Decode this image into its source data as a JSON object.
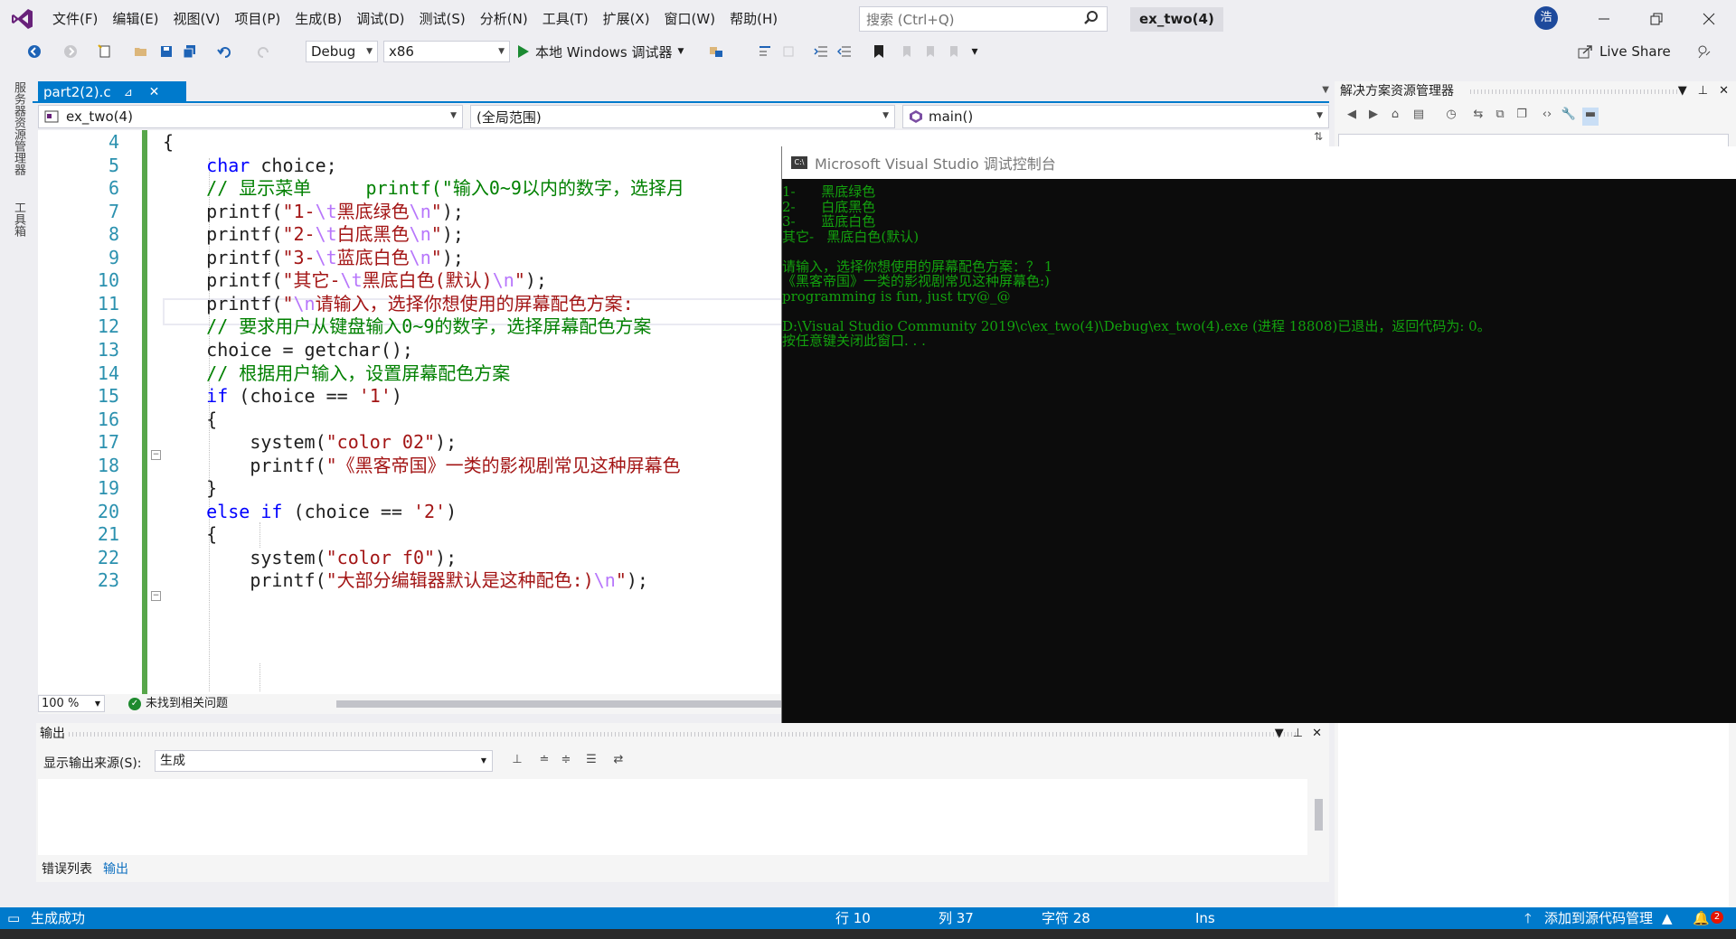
{
  "menu": {
    "items": [
      "文件(F)",
      "编辑(E)",
      "视图(V)",
      "项目(P)",
      "生成(B)",
      "调试(D)",
      "测试(S)",
      "分析(N)",
      "工具(T)",
      "扩展(X)",
      "窗口(W)",
      "帮助(H)"
    ]
  },
  "search": {
    "placeholder": "搜索 (Ctrl+Q)"
  },
  "solution_title": "ex_two(4)",
  "user_avatar_text": "浩",
  "toolbar": {
    "config": "Debug",
    "platform": "x86",
    "run_label": "本地 Windows 调试器",
    "live_share": "Live Share"
  },
  "left_tabs": [
    "服务器资源管理器",
    "工具箱"
  ],
  "document_tab": {
    "title": "part2(2).c"
  },
  "navbar": {
    "project": "ex_two(4)",
    "scope": "(全局范围)",
    "member": "main()"
  },
  "code": {
    "lines": [
      {
        "n": "4",
        "t": "{"
      },
      {
        "n": "5",
        "t": "    char choice;"
      },
      {
        "n": "6",
        "t": "    // 显示菜单     printf(\"输入0~9以内的数字，选择月"
      },
      {
        "n": "7",
        "t": "    printf(\"1-\\t黑底绿色\\n\");"
      },
      {
        "n": "8",
        "t": "    printf(\"2-\\t白底黑色\\n\");"
      },
      {
        "n": "9",
        "t": "    printf(\"3-\\t蓝底白色\\n\");"
      },
      {
        "n": "10",
        "t": "    printf(\"其它-\\t黑底白色(默认)\\n\");"
      },
      {
        "n": "11",
        "t": "    printf(\"\\n请输入，选择你想使用的屏幕配色方案:"
      },
      {
        "n": "12",
        "t": "    // 要求用户从键盘输入0~9的数字，选择屏幕配色方案"
      },
      {
        "n": "13",
        "t": "    choice = getchar();"
      },
      {
        "n": "14",
        "t": "    // 根据用户输入，设置屏幕配色方案"
      },
      {
        "n": "15",
        "t": "    if (choice == '1')"
      },
      {
        "n": "16",
        "t": "    {"
      },
      {
        "n": "17",
        "t": "        system(\"color 02\");"
      },
      {
        "n": "18",
        "t": "        printf(\"《黑客帝国》一类的影视剧常见这种屏幕色"
      },
      {
        "n": "19",
        "t": "    }"
      },
      {
        "n": "20",
        "t": "    else if (choice == '2')"
      },
      {
        "n": "21",
        "t": "    {"
      },
      {
        "n": "22",
        "t": "        system(\"color f0\");"
      },
      {
        "n": "23",
        "t": "        printf(\"大部分编辑器默认是这种配色:)\\n\");"
      }
    ]
  },
  "editor_status": {
    "zoom": "100 %",
    "issues": "未找到相关问题"
  },
  "output": {
    "title": "输出",
    "source_label": "显示输出来源(S):",
    "source_value": "生成"
  },
  "bottom_tabs": [
    "错误列表",
    "输出"
  ],
  "solution_explorer": {
    "title": "解决方案资源管理器"
  },
  "console": {
    "title": "Microsoft Visual Studio 调试控制台",
    "lines": [
      "1-      黑底绿色",
      "2-      白底黑色",
      "3-      蓝底白色",
      "其它-   黑底白色(默认)",
      "",
      "请输入，选择你想使用的屏幕配色方案：？ 1",
      "《黑客帝国》一类的影视剧常见这种屏幕色:)",
      "programming is fun, just try@_@",
      "",
      "D:\\Visual Studio Community 2019\\c\\ex_two(4)\\Debug\\ex_two(4).exe (进程 18808)已退出，返回代码为: 0。",
      "按任意键关闭此窗口. . ."
    ]
  },
  "statusbar": {
    "build": "生成成功",
    "line": "行 10",
    "col": "列 37",
    "char": "字符 28",
    "mode": "Ins",
    "source_control": "添加到源代码管理",
    "notifications": "2"
  },
  "colors": {
    "accent": "#007acc",
    "console_text": "#13a10e",
    "keyword": "#0000ff",
    "comment": "#008000",
    "string": "#a31515"
  }
}
